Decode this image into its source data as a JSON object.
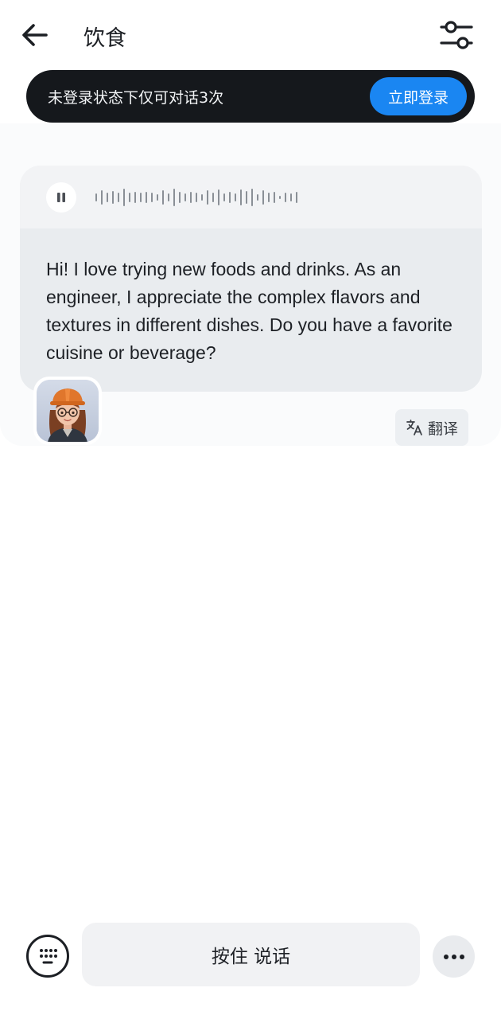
{
  "header": {
    "title": "饮食",
    "back_icon": "back-arrow-icon",
    "settings_icon": "sliders-icon"
  },
  "banner": {
    "text": "未登录状态下仅可对话3次",
    "login_label": "立即登录",
    "login_color": "#1a86f2"
  },
  "message": {
    "audio_icon": "pause-icon",
    "text": "Hi! I love trying new foods and drinks. As an engineer, I appreciate the complex flavors and textures in different dishes. Do you have a favorite cuisine or beverage?",
    "translate_label": "翻译",
    "translate_icon": "translate-icon"
  },
  "input_bar": {
    "talk_label": "按住 说话",
    "keyboard_icon": "keyboard-icon",
    "more_icon": "more-dots-icon"
  }
}
